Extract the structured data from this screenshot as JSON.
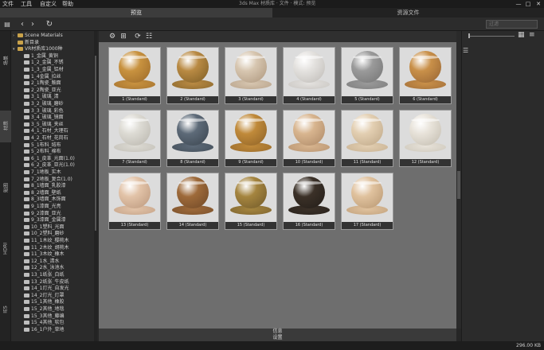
{
  "menu": [
    "文件",
    "工具",
    "自定义",
    "帮助"
  ],
  "window_title": "3ds Max 材质库 · 文件 · 模式: 预览",
  "window_controls": [
    "—",
    "□",
    "✕"
  ],
  "tabs": {
    "preview": "预览",
    "resources": "资源文件"
  },
  "search": {
    "placeholder": "过滤"
  },
  "toolbar": {
    "back": "‹",
    "forward": "›",
    "refresh": "↻",
    "menu": "☰"
  },
  "left_tabs": [
    "场景",
    "材质",
    "贴图",
    "HDRI",
    "IES"
  ],
  "tree": [
    {
      "indent": 0,
      "arrow": "›",
      "icon": "folder",
      "text": "Scene Materials"
    },
    {
      "indent": 0,
      "arrow": "",
      "icon": "folder",
      "text": "新目录"
    },
    {
      "indent": 0,
      "arrow": "▾",
      "icon": "folder",
      "text": "VR材质库1000种"
    },
    {
      "indent": 1,
      "arrow": "",
      "icon": "mat",
      "text": "1_金属_黄铜"
    },
    {
      "indent": 1,
      "arrow": "",
      "icon": "mat",
      "text": "1_2_金属_不锈"
    },
    {
      "indent": 1,
      "arrow": "",
      "icon": "mat",
      "text": "1_3_金属_铝材"
    },
    {
      "indent": 1,
      "arrow": "",
      "icon": "mat",
      "text": "1_4金属_拉丝"
    },
    {
      "indent": 1,
      "arrow": "",
      "icon": "mat",
      "text": "2_1陶瓷_釉面"
    },
    {
      "indent": 1,
      "arrow": "",
      "icon": "mat",
      "text": "2_2陶瓷_亚光"
    },
    {
      "indent": 1,
      "arrow": "",
      "icon": "mat",
      "text": "3_1_玻璃_清"
    },
    {
      "indent": 1,
      "arrow": "",
      "icon": "mat",
      "text": "3_2_玻璃_磨砂"
    },
    {
      "indent": 1,
      "arrow": "",
      "icon": "mat",
      "text": "3_3_玻璃_彩色"
    },
    {
      "indent": 1,
      "arrow": "",
      "icon": "mat",
      "text": "3_4_玻璃_镜面"
    },
    {
      "indent": 1,
      "arrow": "",
      "icon": "mat",
      "text": "3_5_玻璃_夹丝"
    },
    {
      "indent": 1,
      "arrow": "",
      "icon": "mat",
      "text": "4_1_石材_大理石"
    },
    {
      "indent": 1,
      "arrow": "",
      "icon": "mat",
      "text": "4_2_石材_花岗石"
    },
    {
      "indent": 1,
      "arrow": "",
      "icon": "mat",
      "text": "5_1布料_绒布"
    },
    {
      "indent": 1,
      "arrow": "",
      "icon": "mat",
      "text": "5_2布料_棉布"
    },
    {
      "indent": 1,
      "arrow": "",
      "icon": "mat",
      "text": "6_1_皮革_光面(1.0)"
    },
    {
      "indent": 1,
      "arrow": "",
      "icon": "mat",
      "text": "6_2_皮革_亚光(1.0)"
    },
    {
      "indent": 1,
      "arrow": "",
      "icon": "mat",
      "text": "7_1地板_实木"
    },
    {
      "indent": 1,
      "arrow": "",
      "icon": "mat",
      "text": "7_2地板_复合(1.0)"
    },
    {
      "indent": 1,
      "arrow": "",
      "icon": "mat",
      "text": "8_1墙面_乳胶漆"
    },
    {
      "indent": 1,
      "arrow": "",
      "icon": "mat",
      "text": "8_2墙面_壁纸"
    },
    {
      "indent": 1,
      "arrow": "",
      "icon": "mat",
      "text": "8_3墙面_木饰面"
    },
    {
      "indent": 1,
      "arrow": "",
      "icon": "mat",
      "text": "9_1漆面_光亮"
    },
    {
      "indent": 1,
      "arrow": "",
      "icon": "mat",
      "text": "9_2漆面_亚光"
    },
    {
      "indent": 1,
      "arrow": "",
      "icon": "mat",
      "text": "9_3漆面_金属漆"
    },
    {
      "indent": 1,
      "arrow": "",
      "icon": "mat",
      "text": "10_1塑料_光面"
    },
    {
      "indent": 1,
      "arrow": "",
      "icon": "mat",
      "text": "10_2塑料_磨砂"
    },
    {
      "indent": 1,
      "arrow": "",
      "icon": "mat",
      "text": "11_1木纹_樱桃木"
    },
    {
      "indent": 1,
      "arrow": "",
      "icon": "mat",
      "text": "11_2木纹_胡桃木"
    },
    {
      "indent": 1,
      "arrow": "",
      "icon": "mat",
      "text": "11_3木纹_橡木"
    },
    {
      "indent": 1,
      "arrow": "",
      "icon": "mat",
      "text": "12_1水_清水"
    },
    {
      "indent": 1,
      "arrow": "",
      "icon": "mat",
      "text": "12_2水_泳池水"
    },
    {
      "indent": 1,
      "arrow": "",
      "icon": "mat",
      "text": "13_1纸张_白纸"
    },
    {
      "indent": 1,
      "arrow": "",
      "icon": "mat",
      "text": "13_2纸张_牛皮纸"
    },
    {
      "indent": 1,
      "arrow": "",
      "icon": "mat",
      "text": "14_1灯光_自发光"
    },
    {
      "indent": 1,
      "arrow": "",
      "icon": "mat",
      "text": "14_2灯光_灯罩"
    },
    {
      "indent": 1,
      "arrow": "",
      "icon": "mat",
      "text": "15_1其他_橡胶"
    },
    {
      "indent": 1,
      "arrow": "",
      "icon": "mat",
      "text": "15_2其他_地毯"
    },
    {
      "indent": 1,
      "arrow": "",
      "icon": "mat",
      "text": "15_3其他_藤编"
    },
    {
      "indent": 1,
      "arrow": "",
      "icon": "mat",
      "text": "15_4其他_软包"
    },
    {
      "indent": 1,
      "arrow": "",
      "icon": "mat",
      "text": "16_1户外_草地"
    }
  ],
  "materials": [
    {
      "label": "1 (Standard)",
      "color": "#c8923f",
      "base": "#a87530"
    },
    {
      "label": "2 (Standard)",
      "color": "#b98a43",
      "base": "#8e6a2e"
    },
    {
      "label": "3 (Standard)",
      "color": "#d7c6b0",
      "base": "#b9a48c"
    },
    {
      "label": "4 (Standard)",
      "color": "#e4e2df",
      "base": "#c9c6c2"
    },
    {
      "label": "5 (Standard)",
      "color": "#9a9a9a",
      "base": "#7f7f7f"
    },
    {
      "label": "6 (Standard)",
      "color": "#c99049",
      "base": "#a5713a"
    },
    {
      "label": "7 (Standard)",
      "color": "#dddbd4",
      "base": "#c3c0b8"
    },
    {
      "label": "8 (Standard)",
      "color": "#5d6a78",
      "base": "#45505b"
    },
    {
      "label": "9 (Standard)",
      "color": "#c08a3a",
      "base": "#9c6d2c"
    },
    {
      "label": "10 (Standard)",
      "color": "#d8b58f",
      "base": "#b99572"
    },
    {
      "label": "11 (Standard)",
      "color": "#e3cfb2",
      "base": "#c8b293"
    },
    {
      "label": "12 (Standard)",
      "color": "#e8e3da",
      "base": "#cdc7bb"
    },
    {
      "label": "13 (Standard)",
      "color": "#e2c3a8",
      "base": "#c6a489"
    },
    {
      "label": "14 (Standard)",
      "color": "#9e6a3a",
      "base": "#7d522c"
    },
    {
      "label": "15 (Standard)",
      "color": "#a5853f",
      "base": "#806630"
    },
    {
      "label": "16 (Standard)",
      "color": "#3b3128",
      "base": "#2a231d"
    },
    {
      "label": "17 (Standard)",
      "color": "#e0c29e",
      "base": "#c3a37e"
    }
  ],
  "bottom": {
    "line1": "信息",
    "line2": "设置"
  },
  "status": {
    "size": "296.00 KB"
  }
}
